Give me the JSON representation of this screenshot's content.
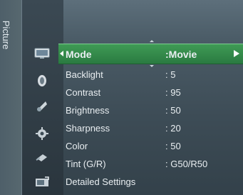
{
  "sidebar": {
    "tab_label": "Picture"
  },
  "icons": [
    {
      "name": "picture-icon"
    },
    {
      "name": "sound-icon"
    },
    {
      "name": "channel-icon"
    },
    {
      "name": "setup-icon"
    },
    {
      "name": "input-icon"
    },
    {
      "name": "application-icon"
    }
  ],
  "menu": {
    "selected": {
      "label": "Mode",
      "value": ":Movie"
    },
    "items": [
      {
        "label": "Backlight",
        "value": ": 5"
      },
      {
        "label": "Contrast",
        "value": ": 95"
      },
      {
        "label": "Brightness",
        "value": ": 50"
      },
      {
        "label": "Sharpness",
        "value": ": 20"
      },
      {
        "label": "Color",
        "value": ": 50"
      },
      {
        "label": "Tint (G/R)",
        "value": ": G50/R50"
      },
      {
        "label": "Detailed Settings",
        "value": ""
      }
    ]
  },
  "colors": {
    "highlight": "#3f9b55",
    "panel": "#3d4c56"
  }
}
